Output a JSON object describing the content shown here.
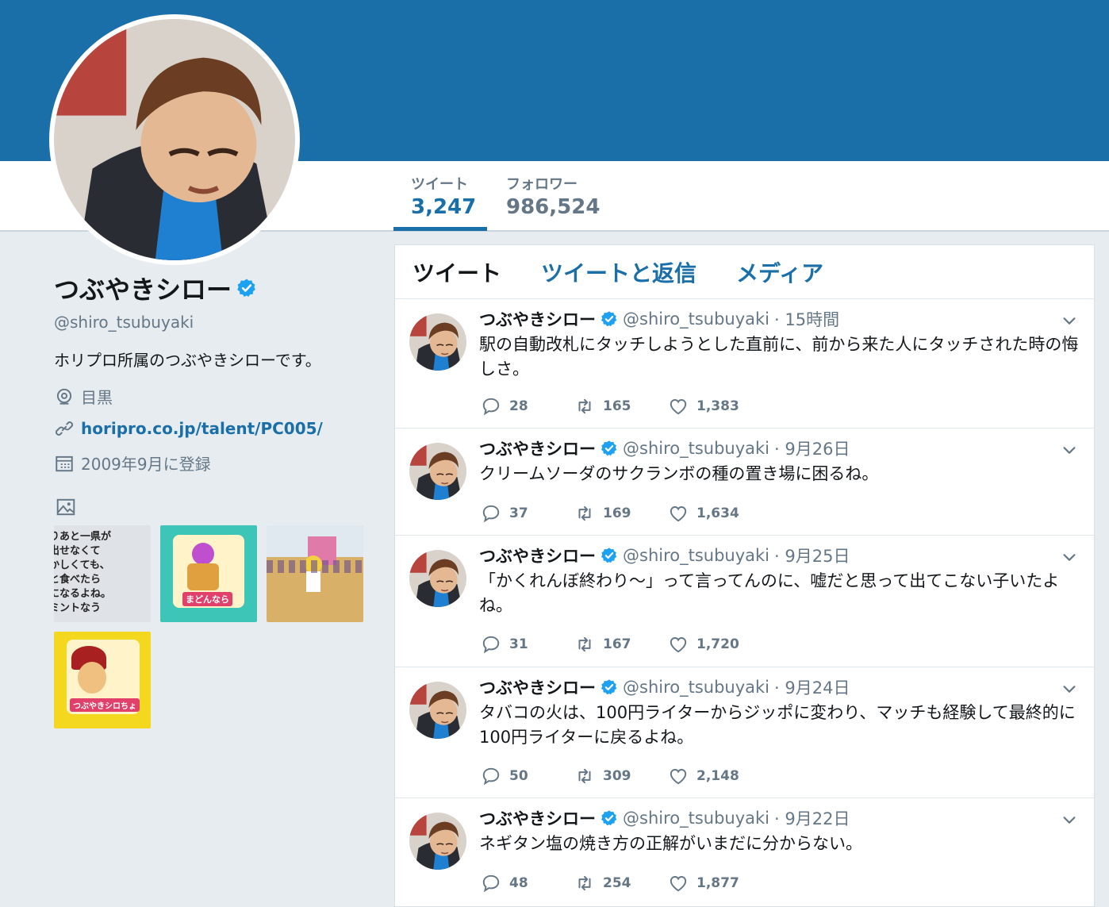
{
  "header": {
    "stats": [
      {
        "label": "ツイート",
        "value": "3,247"
      },
      {
        "label": "フォロワー",
        "value": "986,524"
      }
    ]
  },
  "profile": {
    "name": "つぶやきシロー",
    "handle": "@shiro_tsubuyaki",
    "bio": "ホリプロ所属のつぶやきシローです。",
    "location": "目黒",
    "url": "horipro.co.jp/talent/PC005/",
    "joined": "2009年9月に登録"
  },
  "media_thumbs": [
    {
      "caption": "りあと一県が\n出せなくて\nかしくても、\nと食べたら\nになるよね。\nミントなう"
    },
    {
      "caption": "まどんなら"
    },
    {
      "caption": ""
    },
    {
      "caption": "つぶやきシロちょ"
    }
  ],
  "timeline": {
    "tabs": [
      "ツイート",
      "ツイートと返信",
      "メディア"
    ],
    "tweets": [
      {
        "name": "つぶやきシロー",
        "handle": "@shiro_tsubuyaki",
        "time": "· 15時間",
        "text": "駅の自動改札にタッチしようとした直前に、前から来た人にタッチされた時の悔しさ。",
        "replies": "28",
        "retweets": "165",
        "likes": "1,383"
      },
      {
        "name": "つぶやきシロー",
        "handle": "@shiro_tsubuyaki",
        "time": "· 9月26日",
        "text": "クリームソーダのサクランボの種の置き場に困るね。",
        "replies": "37",
        "retweets": "169",
        "likes": "1,634"
      },
      {
        "name": "つぶやきシロー",
        "handle": "@shiro_tsubuyaki",
        "time": "· 9月25日",
        "text": "「かくれんぼ終わり〜」って言ってんのに、嘘だと思って出てこない子いたよね。",
        "replies": "31",
        "retweets": "167",
        "likes": "1,720"
      },
      {
        "name": "つぶやきシロー",
        "handle": "@shiro_tsubuyaki",
        "time": "· 9月24日",
        "text": "タバコの火は、100円ライターからジッポに変わり、マッチも経験して最終的に100円ライターに戻るよね。",
        "replies": "50",
        "retweets": "309",
        "likes": "2,148"
      },
      {
        "name": "つぶやきシロー",
        "handle": "@shiro_tsubuyaki",
        "time": "· 9月22日",
        "text": "ネギタン塩の焼き方の正解がいまだに分からない。",
        "replies": "48",
        "retweets": "254",
        "likes": "1,877"
      }
    ]
  },
  "colors": {
    "banner": "#1a6fa8",
    "accent": "#1a6fa8",
    "verified": "#1da1f2",
    "background": "#e6ecf0"
  },
  "icons": [
    "verified-badge-icon",
    "location-pin-icon",
    "link-icon",
    "calendar-icon",
    "image-icon",
    "chevron-down-icon",
    "reply-icon",
    "retweet-icon",
    "like-icon"
  ]
}
